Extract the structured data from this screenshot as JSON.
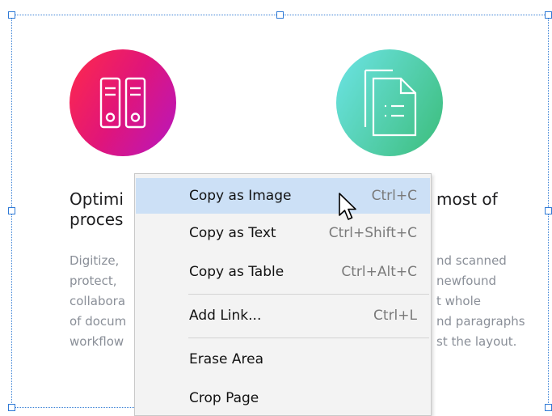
{
  "background": {
    "left_heading_line1": "Optimi",
    "left_heading_line2": "proces",
    "right_heading_line1": "most of",
    "left_body_lines": [
      "Digitize,",
      "protect,",
      "collabora",
      "of docum",
      "workflow"
    ],
    "right_body_lines": [
      "nd scanned",
      "newfound",
      "t whole",
      "nd paragraphs",
      "st the layout."
    ]
  },
  "icons": {
    "left_circle": "binders-icon",
    "right_circle": "document-icon"
  },
  "colors": {
    "selection": "#3b82d6",
    "menu_hover": "#cce0f6",
    "menu_bg": "#f3f3f3"
  },
  "context_menu": {
    "items": [
      {
        "label": "Copy as Image",
        "shortcut": "Ctrl+C"
      },
      {
        "label": "Copy as Text",
        "shortcut": "Ctrl+Shift+C"
      },
      {
        "label": "Copy as Table",
        "shortcut": "Ctrl+Alt+C"
      },
      {
        "label": "Add Link...",
        "shortcut": "Ctrl+L"
      },
      {
        "label": "Erase Area",
        "shortcut": ""
      },
      {
        "label": "Crop Page",
        "shortcut": ""
      }
    ]
  }
}
